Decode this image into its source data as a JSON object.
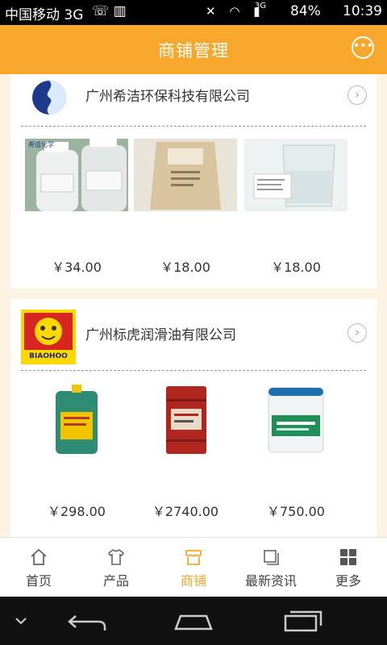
{
  "status_bar": {
    "carrier": "中国移动 3G",
    "network": "3G",
    "battery": "84%",
    "time": "10:39"
  },
  "header": {
    "title": "商铺管理",
    "chat_icon": "chat-bubble-icon"
  },
  "shops": [
    {
      "name": "广州希洁环保科技有限公司",
      "products": [
        {
          "price": "￥34.00",
          "image_label": "希适化学"
        },
        {
          "price": "￥18.00"
        },
        {
          "price": "￥18.00"
        }
      ]
    },
    {
      "name": "广州标虎润滑油有限公司",
      "logo_text": "BIAOHOO",
      "products": [
        {
          "price": "￥298.00"
        },
        {
          "price": "￥2740.00"
        },
        {
          "price": "￥750.00"
        }
      ]
    }
  ],
  "bottom_nav": [
    {
      "label": "首页",
      "icon": "home-icon"
    },
    {
      "label": "产品",
      "icon": "shirt-icon"
    },
    {
      "label": "商铺",
      "icon": "store-icon",
      "active": true
    },
    {
      "label": "最新资讯",
      "icon": "news-icon"
    },
    {
      "label": "更多",
      "icon": "grid-icon"
    }
  ],
  "colors": {
    "accent": "#f7a82c",
    "page_bg": "#fdf3e3"
  }
}
